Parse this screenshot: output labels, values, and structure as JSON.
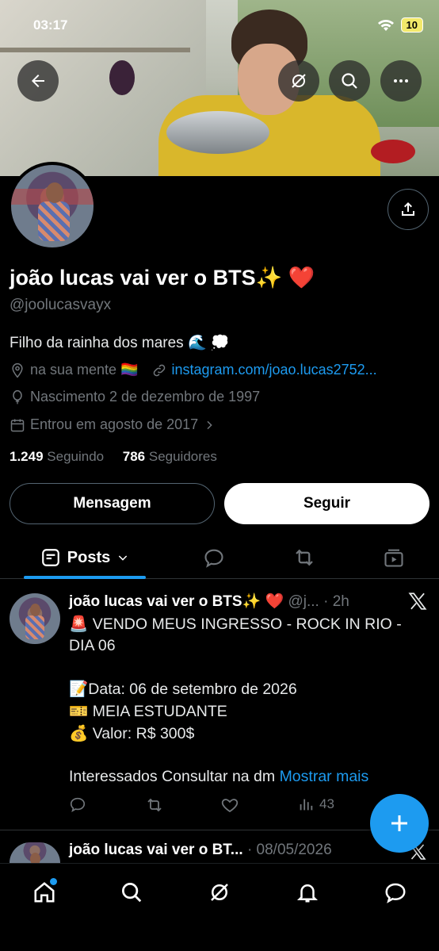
{
  "status_bar": {
    "time": "03:17",
    "battery": "10"
  },
  "profile": {
    "name": "joão lucas vai ver o BTS✨ ❤️",
    "handle": "@joolucasvayx",
    "bio": "Filho da rainha dos mares 🌊 💭",
    "location": "na sua mente 🏳️‍🌈",
    "link": "instagram.com/joao.lucas2752...",
    "birth": "Nascimento 2 de dezembro de 1997",
    "joined": "Entrou em agosto de 2017",
    "following_count": "1.249",
    "following_label": "Seguindo",
    "followers_count": "786",
    "followers_label": "Seguidores"
  },
  "buttons": {
    "message": "Mensagem",
    "follow": "Seguir"
  },
  "tabs": {
    "posts": "Posts"
  },
  "tweets": [
    {
      "name": "joão lucas vai ver o BTS✨ ❤️",
      "meta": "@j... · 2h",
      "lines": [
        "🚨 VENDO MEUS INGRESSO - ROCK IN RIO -",
        "DIA 06",
        "📝Data: 06 de setembro de 2026",
        "🎫  MEIA ESTUDANTE",
        "💰 Valor: R$ 300$",
        "Interessados Consultar na dm"
      ],
      "show_more": "Mostrar mais",
      "views": "43"
    },
    {
      "name": "joão lucas vai ver o BT...",
      "meta": "· 08/05/2026"
    }
  ]
}
